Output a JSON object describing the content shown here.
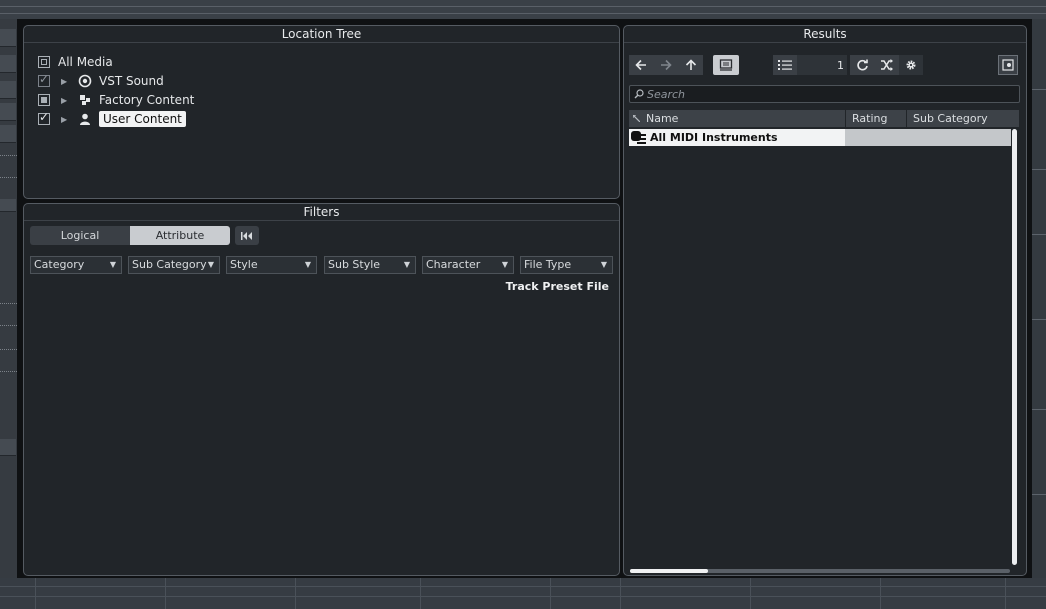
{
  "location_tree": {
    "title": "Location Tree",
    "items": [
      {
        "label": "All Media"
      },
      {
        "label": "VST Sound"
      },
      {
        "label": "Factory Content"
      },
      {
        "label": "User Content"
      }
    ]
  },
  "filters": {
    "title": "Filters",
    "tabs": {
      "logical": "Logical",
      "attribute": "Attribute"
    },
    "dropdowns": [
      "Category",
      "Sub Category",
      "Style",
      "Sub Style",
      "Character",
      "File Type"
    ],
    "file_type_value": "Track Preset File"
  },
  "results": {
    "title": "Results",
    "count": "1",
    "search_placeholder": "Search",
    "columns": {
      "name": "Name",
      "rating": "Rating",
      "sub_category": "Sub Category"
    },
    "rows": [
      {
        "name": "All MIDI Instruments",
        "rating": "",
        "sub_category": ""
      }
    ]
  }
}
